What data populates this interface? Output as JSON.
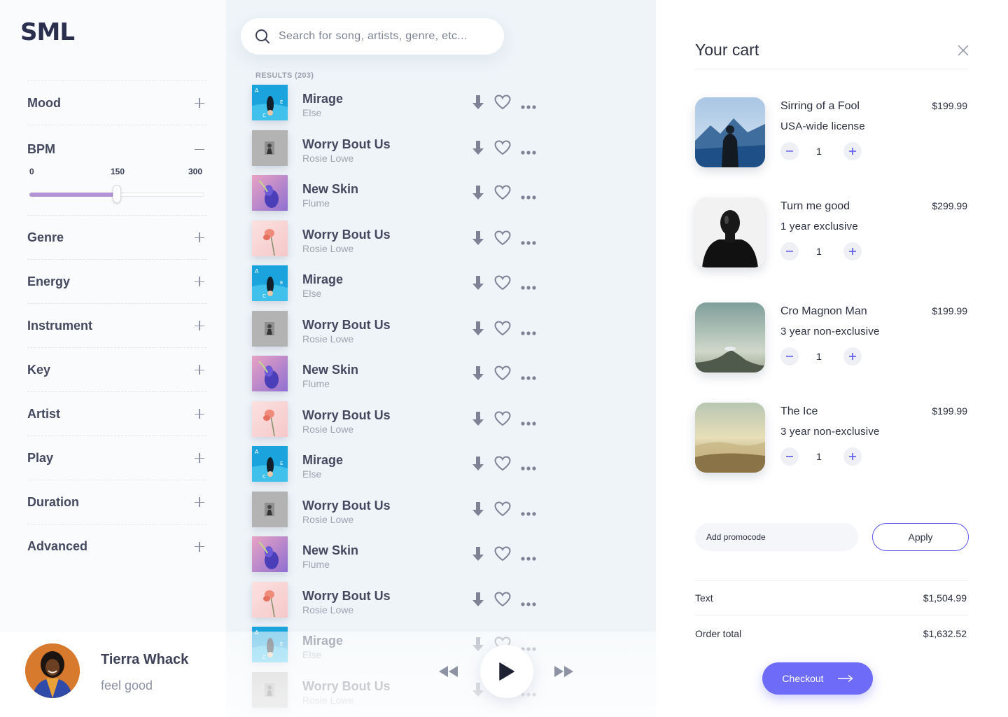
{
  "brand": {
    "logo": "SML"
  },
  "sidebar": {
    "filters": [
      {
        "label": "Mood",
        "expanded": false
      },
      {
        "label": "BPM",
        "expanded": true
      },
      {
        "label": "Genre",
        "expanded": false
      },
      {
        "label": "Energy",
        "expanded": false
      },
      {
        "label": "Instrument",
        "expanded": false
      },
      {
        "label": "Key",
        "expanded": false
      },
      {
        "label": "Artist",
        "expanded": false
      },
      {
        "label": "Play",
        "expanded": false
      },
      {
        "label": "Duration",
        "expanded": false
      },
      {
        "label": "Advanced",
        "expanded": false
      }
    ],
    "bpm": {
      "min_label": "0",
      "mid_label": "150",
      "max_label": "300",
      "min": 0,
      "max": 300,
      "value": 150
    }
  },
  "user": {
    "name": "Tierra Whack",
    "status": "feel good"
  },
  "search": {
    "placeholder": "Search for song, artists, genre, etc..."
  },
  "results": {
    "label": "RESULTS (203)",
    "tracks": [
      {
        "title": "Mirage",
        "artist": "Else",
        "cover": "mirage"
      },
      {
        "title": "Worry Bout Us",
        "artist": "Rosie Lowe",
        "cover": "gray"
      },
      {
        "title": "New Skin",
        "artist": "Flume",
        "cover": "newskin"
      },
      {
        "title": "Worry Bout Us",
        "artist": "Rosie Lowe",
        "cover": "pink"
      },
      {
        "title": "Mirage",
        "artist": "Else",
        "cover": "mirage"
      },
      {
        "title": "Worry Bout Us",
        "artist": "Rosie Lowe",
        "cover": "gray"
      },
      {
        "title": "New Skin",
        "artist": "Flume",
        "cover": "newskin"
      },
      {
        "title": "Worry Bout Us",
        "artist": "Rosie Lowe",
        "cover": "pink"
      },
      {
        "title": "Mirage",
        "artist": "Else",
        "cover": "mirage"
      },
      {
        "title": "Worry Bout Us",
        "artist": "Rosie Lowe",
        "cover": "gray"
      },
      {
        "title": "New Skin",
        "artist": "Flume",
        "cover": "newskin"
      },
      {
        "title": "Worry Bout Us",
        "artist": "Rosie Lowe",
        "cover": "pink"
      },
      {
        "title": "Mirage",
        "artist": "Else",
        "cover": "mirage"
      },
      {
        "title": "Worry Bout Us",
        "artist": "Rosie Lowe",
        "cover": "gray"
      }
    ]
  },
  "icons": {
    "search": "search-icon",
    "download": "download-arrow-icon",
    "like": "heart-icon",
    "more": "more-dots-icon",
    "play": "play-icon",
    "rewind": "rewind-icon",
    "forward": "fast-forward-icon",
    "close": "close-icon",
    "arrow": "arrow-right-icon"
  },
  "cart": {
    "title": "Your cart",
    "items": [
      {
        "name": "Sirring of a Fool",
        "price": "$199.99",
        "license": "USA-wide license",
        "qty": "1",
        "thumb": "mountain-man"
      },
      {
        "name": "Turn me good",
        "price": "$299.99",
        "license": "1 year exclusive",
        "qty": "1",
        "thumb": "portrait"
      },
      {
        "name": "Cro Magnon Man",
        "price": "$199.99",
        "license": "3 year non-exclusive",
        "qty": "1",
        "thumb": "volcano"
      },
      {
        "name": "The Ice",
        "price": "$199.99",
        "license": "3 year non-exclusive",
        "qty": "1",
        "thumb": "hills"
      }
    ],
    "promo_placeholder": "Add promocode",
    "apply_label": "Apply",
    "summary": [
      {
        "label": "Text",
        "value": "$1,504.99"
      },
      {
        "label": "Order total",
        "value": "$1,632.52"
      }
    ],
    "checkout_label": "Checkout"
  },
  "colors": {
    "accent": "#6d6bf7",
    "slider_fill": "#b193d6",
    "list_bg": "#eef4f8",
    "text": "#3d4158"
  }
}
